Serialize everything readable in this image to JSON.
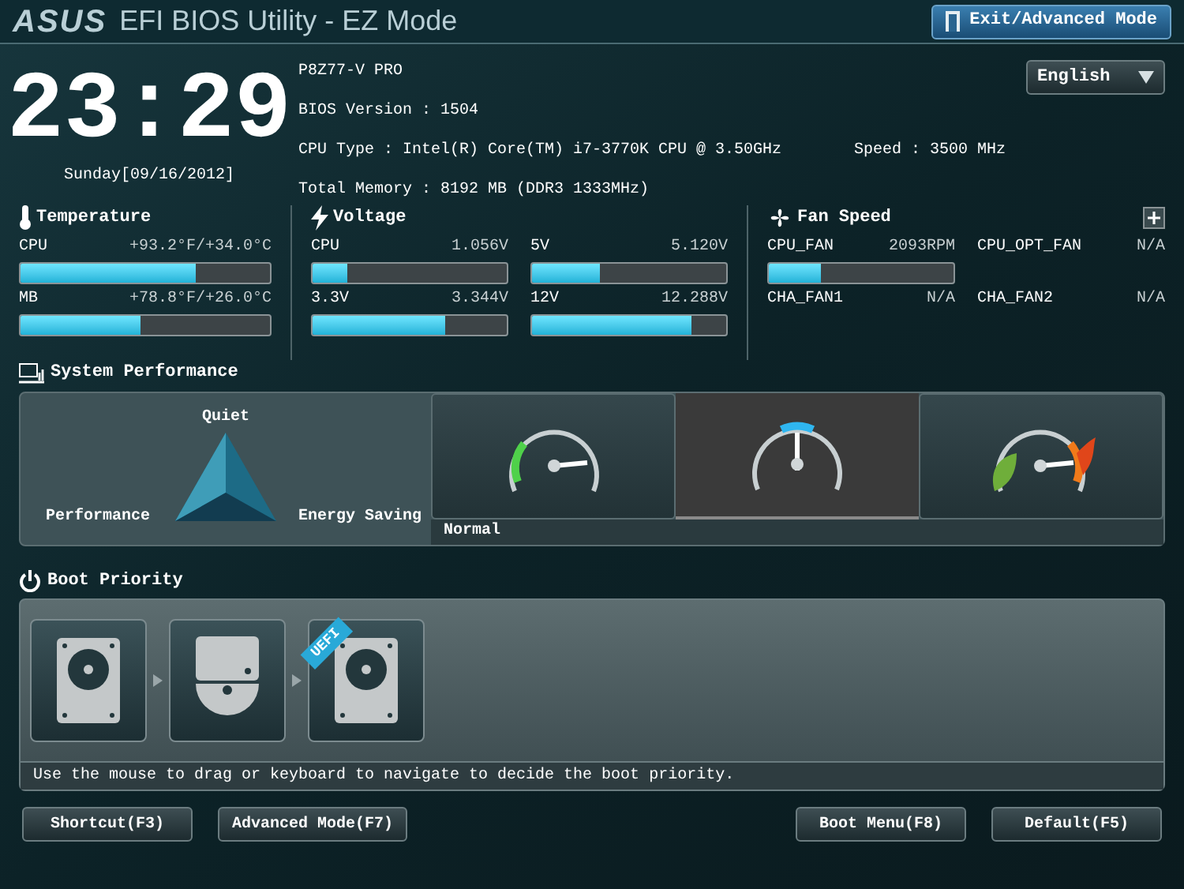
{
  "header": {
    "logo": "ASUS",
    "title": "EFI BIOS Utility - EZ Mode",
    "exit_button": "Exit/Advanced Mode"
  },
  "clock": {
    "time": "23:29",
    "date": "Sunday[09/16/2012]"
  },
  "system_info": {
    "model": "P8Z77-V PRO",
    "bios_version": "BIOS Version : 1504",
    "cpu_type": "CPU Type : Intel(R) Core(TM) i7-3770K CPU @ 3.50GHz",
    "speed": "Speed : 3500 MHz",
    "memory": "Total Memory : 8192 MB (DDR3 1333MHz)"
  },
  "language": {
    "value": "English"
  },
  "temperature": {
    "title": "Temperature",
    "items": [
      {
        "name": "CPU",
        "reading": "+93.2°F/+34.0°C",
        "level": 0.7
      },
      {
        "name": "MB",
        "reading": "+78.8°F/+26.0°C",
        "level": 0.48
      }
    ]
  },
  "voltage": {
    "title": "Voltage",
    "items": [
      {
        "name": "CPU",
        "reading": "1.056V",
        "level": 0.18
      },
      {
        "name": "5V",
        "reading": "5.120V",
        "level": 0.35
      },
      {
        "name": "3.3V",
        "reading": "3.344V",
        "level": 0.68
      },
      {
        "name": "12V",
        "reading": "12.288V",
        "level": 0.82
      }
    ]
  },
  "fan_speed": {
    "title": "Fan Speed",
    "items": [
      {
        "name": "CPU_FAN",
        "reading": "2093RPM",
        "kind": "bar",
        "level": 0.28
      },
      {
        "name": "CPU_OPT_FAN",
        "reading": "N/A",
        "kind": "plain"
      },
      {
        "name": "CHA_FAN1",
        "reading": "N/A",
        "kind": "plain"
      },
      {
        "name": "CHA_FAN2",
        "reading": "N/A",
        "kind": "plain"
      }
    ]
  },
  "system_performance": {
    "title": "System Performance",
    "triangle": {
      "top": "Quiet",
      "left": "Performance",
      "right": "Energy Saving"
    },
    "modes": [
      {
        "kind": "quiet",
        "selected": false
      },
      {
        "kind": "normal",
        "selected": true
      },
      {
        "kind": "eco",
        "selected": false
      }
    ],
    "selected_label": "Normal"
  },
  "boot_priority": {
    "title": "Boot Priority",
    "devices": [
      {
        "kind": "hdd"
      },
      {
        "kind": "optical"
      },
      {
        "kind": "hdd",
        "badge": "UEFI"
      }
    ],
    "hint": "Use the mouse to drag or keyboard to navigate to decide the boot priority."
  },
  "footer": {
    "left_buttons": [
      "Shortcut(F3)",
      "Advanced Mode(F7)"
    ],
    "right_buttons": [
      "Boot Menu(F8)",
      "Default(F5)"
    ]
  }
}
